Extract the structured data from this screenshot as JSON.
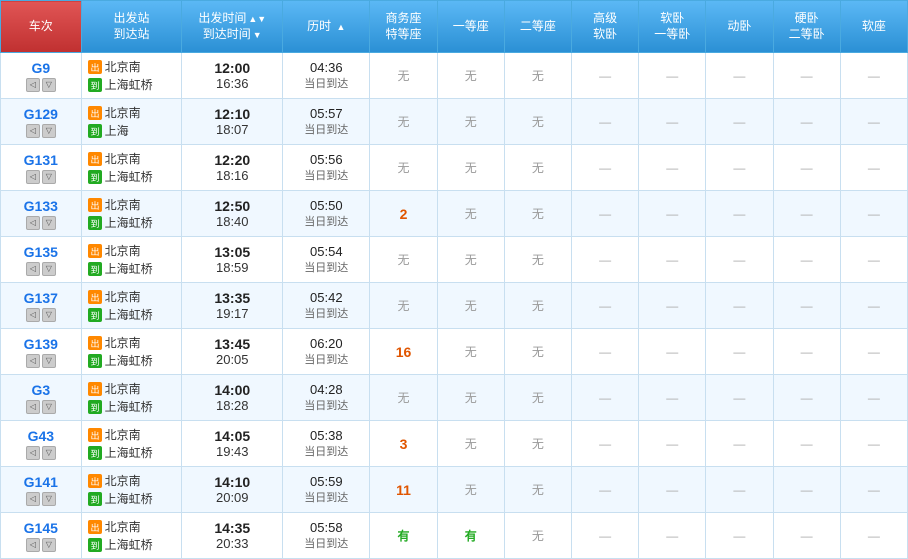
{
  "header": {
    "cols": [
      {
        "id": "train",
        "label": "车次",
        "width": 72,
        "sortable": false,
        "active": true
      },
      {
        "id": "station",
        "label1": "出发站",
        "label2": "到达站",
        "width": 90,
        "sortable": false
      },
      {
        "id": "time",
        "label1": "出发时间",
        "label2": "到达时间",
        "width": 90,
        "sortable": true,
        "arrow": "▲▼"
      },
      {
        "id": "duration",
        "label": "历时",
        "width": 78,
        "sortable": true,
        "arrow": "▲"
      },
      {
        "id": "biz",
        "label1": "商务座",
        "label2": "特等座",
        "width": 60
      },
      {
        "id": "first",
        "label": "一等座",
        "width": 60
      },
      {
        "id": "second",
        "label": "二等座",
        "width": 60
      },
      {
        "id": "adv_soft",
        "label1": "高级",
        "label2": "软卧",
        "width": 60
      },
      {
        "id": "soft_first",
        "label1": "软卧",
        "label2": "一等卧",
        "width": 60
      },
      {
        "id": "moving",
        "label": "动卧",
        "width": 55
      },
      {
        "id": "hard_second",
        "label1": "硬卧",
        "label2": "二等卧",
        "width": 60
      },
      {
        "id": "soft_seat",
        "label": "软座",
        "width": 55
      }
    ]
  },
  "rows": [
    {
      "train": "G9",
      "depart_station": "北京南",
      "arrive_station": "上海虹桥",
      "depart_time": "12:00",
      "arrive_time": "16:36",
      "duration": "04:36",
      "same_day": "当日到达",
      "biz": "无",
      "first": "无",
      "second": "无",
      "adv_soft": "—",
      "soft_first": "—",
      "moving": "—",
      "hard_second": "—",
      "soft_seat": "—"
    },
    {
      "train": "G129",
      "depart_station": "北京南",
      "arrive_station": "上海",
      "depart_time": "12:10",
      "arrive_time": "18:07",
      "duration": "05:57",
      "same_day": "当日到达",
      "biz": "无",
      "first": "无",
      "second": "无",
      "adv_soft": "—",
      "soft_first": "—",
      "moving": "—",
      "hard_second": "—",
      "soft_seat": "—"
    },
    {
      "train": "G131",
      "depart_station": "北京南",
      "arrive_station": "上海虹桥",
      "depart_time": "12:20",
      "arrive_time": "18:16",
      "duration": "05:56",
      "same_day": "当日到达",
      "biz": "无",
      "first": "无",
      "second": "无",
      "adv_soft": "—",
      "soft_first": "—",
      "moving": "—",
      "hard_second": "—",
      "soft_seat": "—"
    },
    {
      "train": "G133",
      "depart_station": "北京南",
      "arrive_station": "上海虹桥",
      "depart_time": "12:50",
      "arrive_time": "18:40",
      "duration": "05:50",
      "same_day": "当日到达",
      "biz": "2",
      "first": "无",
      "second": "无",
      "adv_soft": "—",
      "soft_first": "—",
      "moving": "—",
      "hard_second": "—",
      "soft_seat": "—"
    },
    {
      "train": "G135",
      "depart_station": "北京南",
      "arrive_station": "上海虹桥",
      "depart_time": "13:05",
      "arrive_time": "18:59",
      "duration": "05:54",
      "same_day": "当日到达",
      "biz": "无",
      "first": "无",
      "second": "无",
      "adv_soft": "—",
      "soft_first": "—",
      "moving": "—",
      "hard_second": "—",
      "soft_seat": "—"
    },
    {
      "train": "G137",
      "depart_station": "北京南",
      "arrive_station": "上海虹桥",
      "depart_time": "13:35",
      "arrive_time": "19:17",
      "duration": "05:42",
      "same_day": "当日到达",
      "biz": "无",
      "first": "无",
      "second": "无",
      "adv_soft": "—",
      "soft_first": "—",
      "moving": "—",
      "hard_second": "—",
      "soft_seat": "—"
    },
    {
      "train": "G139",
      "depart_station": "北京南",
      "arrive_station": "上海虹桥",
      "depart_time": "13:45",
      "arrive_time": "20:05",
      "duration": "06:20",
      "same_day": "当日到达",
      "biz": "16",
      "first": "无",
      "second": "无",
      "adv_soft": "—",
      "soft_first": "—",
      "moving": "—",
      "hard_second": "—",
      "soft_seat": "—"
    },
    {
      "train": "G3",
      "depart_station": "北京南",
      "arrive_station": "上海虹桥",
      "depart_time": "14:00",
      "arrive_time": "18:28",
      "duration": "04:28",
      "same_day": "当日到达",
      "biz": "无",
      "first": "无",
      "second": "无",
      "adv_soft": "—",
      "soft_first": "—",
      "moving": "—",
      "hard_second": "—",
      "soft_seat": "—"
    },
    {
      "train": "G43",
      "depart_station": "北京南",
      "arrive_station": "上海虹桥",
      "depart_time": "14:05",
      "arrive_time": "19:43",
      "duration": "05:38",
      "same_day": "当日到达",
      "biz": "3",
      "first": "无",
      "second": "无",
      "adv_soft": "—",
      "soft_first": "—",
      "moving": "—",
      "hard_second": "—",
      "soft_seat": "—"
    },
    {
      "train": "G141",
      "depart_station": "北京南",
      "arrive_station": "上海虹桥",
      "depart_time": "14:10",
      "arrive_time": "20:09",
      "duration": "05:59",
      "same_day": "当日到达",
      "biz": "11",
      "first": "无",
      "second": "无",
      "adv_soft": "—",
      "soft_first": "—",
      "moving": "—",
      "hard_second": "—",
      "soft_seat": "—"
    },
    {
      "train": "G145",
      "depart_station": "北京南",
      "arrive_station": "上海虹桥",
      "depart_time": "14:35",
      "arrive_time": "20:33",
      "duration": "05:58",
      "same_day": "当日到达",
      "biz": "有",
      "first": "有",
      "second": "无",
      "adv_soft": "—",
      "soft_first": "—",
      "moving": "—",
      "hard_second": "—",
      "soft_seat": "—"
    }
  ]
}
